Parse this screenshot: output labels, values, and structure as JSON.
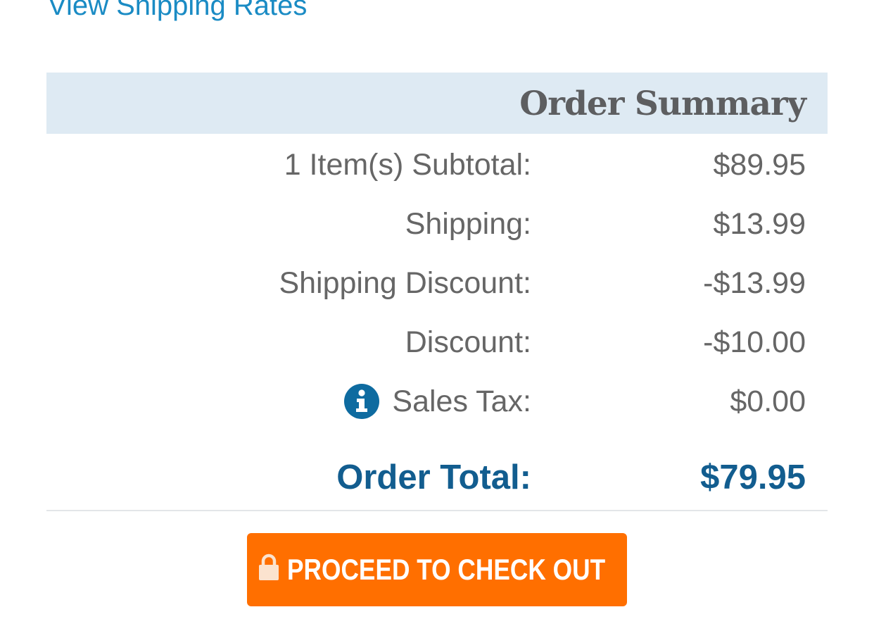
{
  "shipping_link": {
    "label": "View Shipping Rates"
  },
  "order_summary": {
    "title": "Order Summary",
    "rows": [
      {
        "label": "1 Item(s) Subtotal:",
        "value": "$89.95"
      },
      {
        "label": "Shipping:",
        "value": "$13.99"
      },
      {
        "label": "Shipping Discount:",
        "value": "-$13.99"
      },
      {
        "label": "Discount:",
        "value": "-$10.00"
      },
      {
        "label": "Sales Tax:",
        "value": "$0.00",
        "icon": "info-icon"
      }
    ],
    "total": {
      "label": "Order Total:",
      "value": "$79.95"
    }
  },
  "checkout": {
    "label": "PROCEED TO CHECK OUT",
    "icon": "lock-icon"
  },
  "colors": {
    "link": "#1a8bc4",
    "header_bg": "#deeaf3",
    "text": "#666666",
    "total": "#125d8f",
    "button": "#ff6f00",
    "info_icon": "#0e6ba0"
  }
}
